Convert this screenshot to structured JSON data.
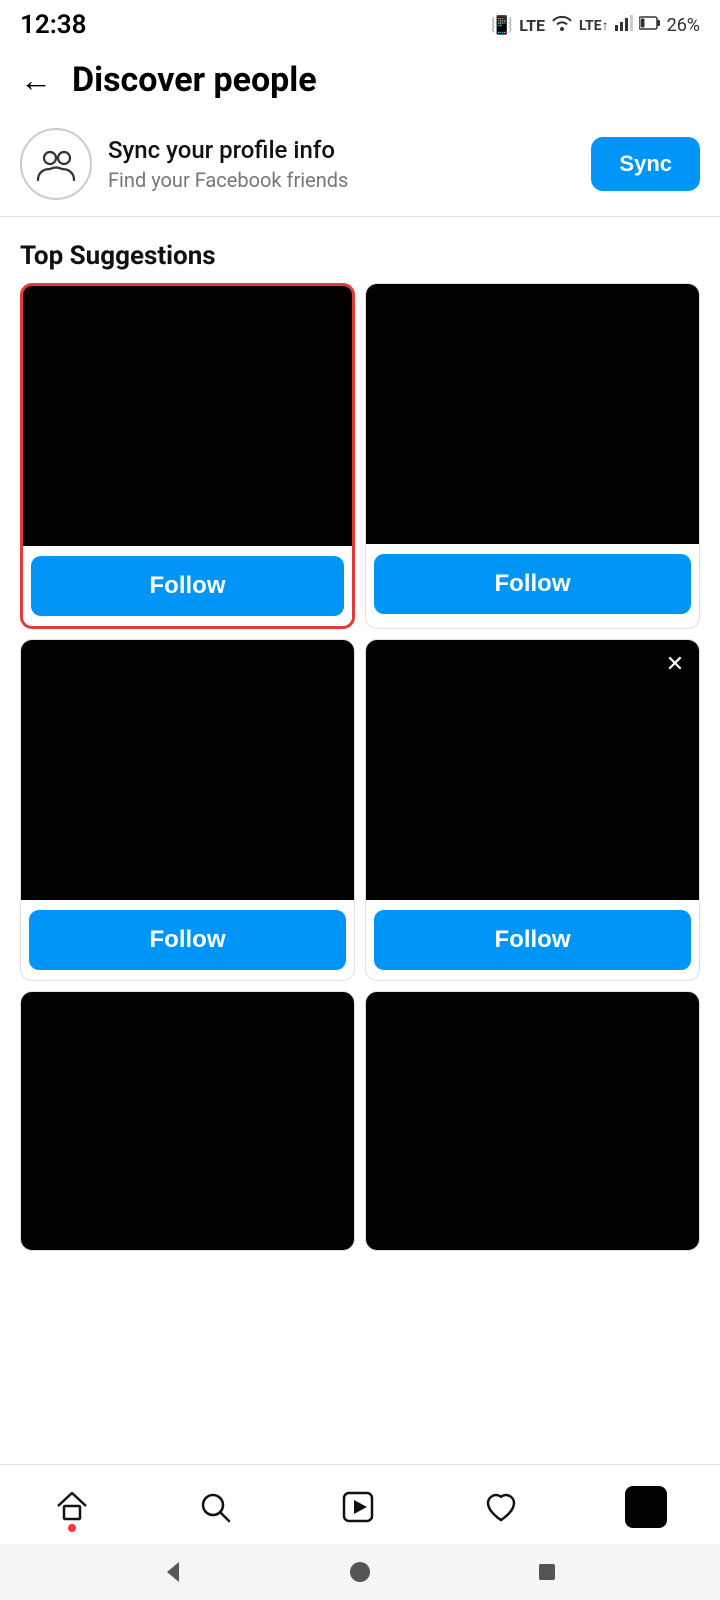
{
  "statusBar": {
    "time": "12:38",
    "battery": "26%",
    "icons": [
      "vibrate",
      "lte-call",
      "wifi",
      "lte",
      "signal1",
      "signal2",
      "battery"
    ]
  },
  "header": {
    "backLabel": "←",
    "title": "Discover people"
  },
  "syncSection": {
    "title": "Sync your profile info",
    "subtitle": "Find your Facebook friends",
    "buttonLabel": "Sync"
  },
  "sectionTitle": "Top Suggestions",
  "suggestions": [
    {
      "id": 1,
      "followLabel": "Follow",
      "highlighted": true,
      "hasDismiss": false
    },
    {
      "id": 2,
      "followLabel": "Follow",
      "highlighted": false,
      "hasDismiss": false
    },
    {
      "id": 3,
      "followLabel": "Follow",
      "highlighted": false,
      "hasDismiss": false
    },
    {
      "id": 4,
      "followLabel": "Follow",
      "highlighted": false,
      "hasDismiss": true
    }
  ],
  "partialCards": [
    {
      "id": 5
    },
    {
      "id": 6
    }
  ],
  "bottomNav": {
    "items": [
      {
        "name": "home",
        "icon": "home-icon"
      },
      {
        "name": "search",
        "icon": "search-icon"
      },
      {
        "name": "reels",
        "icon": "reels-icon"
      },
      {
        "name": "heart",
        "icon": "heart-icon"
      },
      {
        "name": "profile",
        "icon": "profile-icon"
      }
    ]
  },
  "systemNav": {
    "back": "◀",
    "home": "●",
    "recents": "■"
  }
}
